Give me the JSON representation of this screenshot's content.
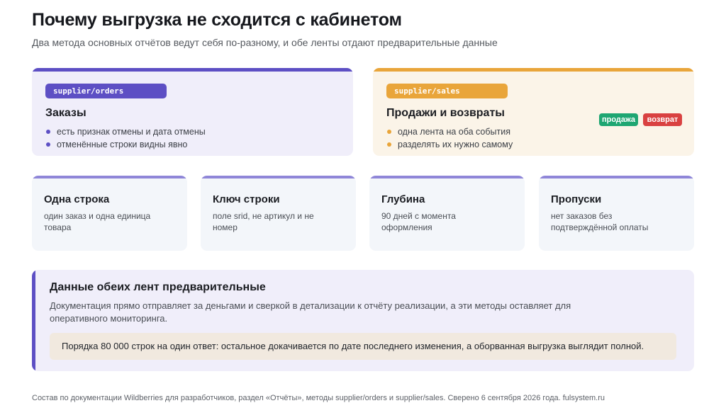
{
  "page": {
    "title": "Почему выгрузка не сходится с кабинетом",
    "subtitle": "Два метода основных отчётов ведут себя по-разному, и обе ленты отдают предварительные данные"
  },
  "orders_card": {
    "endpoint": "supplier/orders",
    "title": "Заказы",
    "bullets": [
      "есть признак отмены и дата отмены",
      "отменённые строки видны явно"
    ],
    "accent_color": "#5d4fc4"
  },
  "sales_card": {
    "endpoint": "supplier/sales",
    "title": "Продажи и возвраты",
    "bullets": [
      "одна лента на оба события",
      "разделять их нужно самому"
    ],
    "badges": [
      "продажа",
      "возврат"
    ],
    "accent_color": "#e9a53a",
    "badge_colors": [
      "#1ea672",
      "#d94141"
    ]
  },
  "facts": [
    {
      "title": "Одна строка",
      "text": "один заказ и одна единица товара"
    },
    {
      "title": "Ключ строки",
      "text": "поле srid, не артикул и не номер"
    },
    {
      "title": "Глубина",
      "text": "90 дней с момента оформления"
    },
    {
      "title": "Пропуски",
      "text": "нет заказов без подтверждённой оплаты"
    }
  ],
  "note": {
    "title": "Данные обеих лент предварительные",
    "text": "Документация прямо отправляет за деньгами и сверкой в детализации к отчёту реализации, а эти методы оставляет для оперативного мониторинга.",
    "callout": "Порядка 80 000 строк на один ответ: остальное докачивается по дате последнего изменения, а оборванная выгрузка выглядит полной."
  },
  "footer": "Состав по документации Wildberries для разработчиков, раздел «Отчёты», методы supplier/orders и supplier/sales. Сверено 6 сентября 2026 года. fulsystem.ru"
}
